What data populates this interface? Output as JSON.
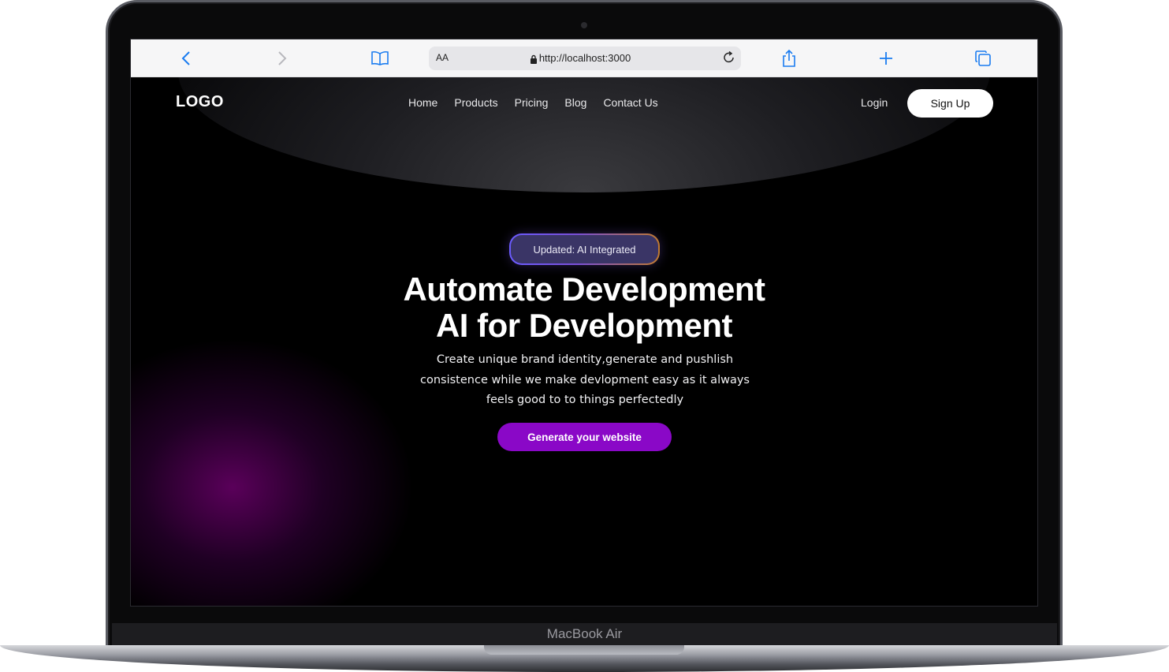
{
  "browser": {
    "text_size_label": "AA",
    "url": "http://localhost:3000",
    "icons": [
      "back-icon",
      "forward-icon",
      "bookmarks-icon",
      "lock-icon",
      "reload-icon",
      "share-icon",
      "new-tab-icon",
      "tabs-icon"
    ],
    "accent_color": "#1a7cf0"
  },
  "nav": {
    "logo": "LOGO",
    "links": [
      "Home",
      "Products",
      "Pricing",
      "Blog",
      "Contact Us"
    ],
    "login": "Login",
    "signup": "Sign Up"
  },
  "hero": {
    "badge": "Updated: AI Integrated",
    "headline_line1": "Automate Development",
    "headline_line2": "AI for Development",
    "subtext_line1": "Create unique brand identity,generate and pushlish",
    "subtext_line2": "consistence while we make devlopment easy as it always",
    "subtext_line3": "feels good to to things perfectedly",
    "cta": "Generate your website",
    "cta_color": "#8a08c7"
  },
  "device": {
    "label": "MacBook Air"
  }
}
